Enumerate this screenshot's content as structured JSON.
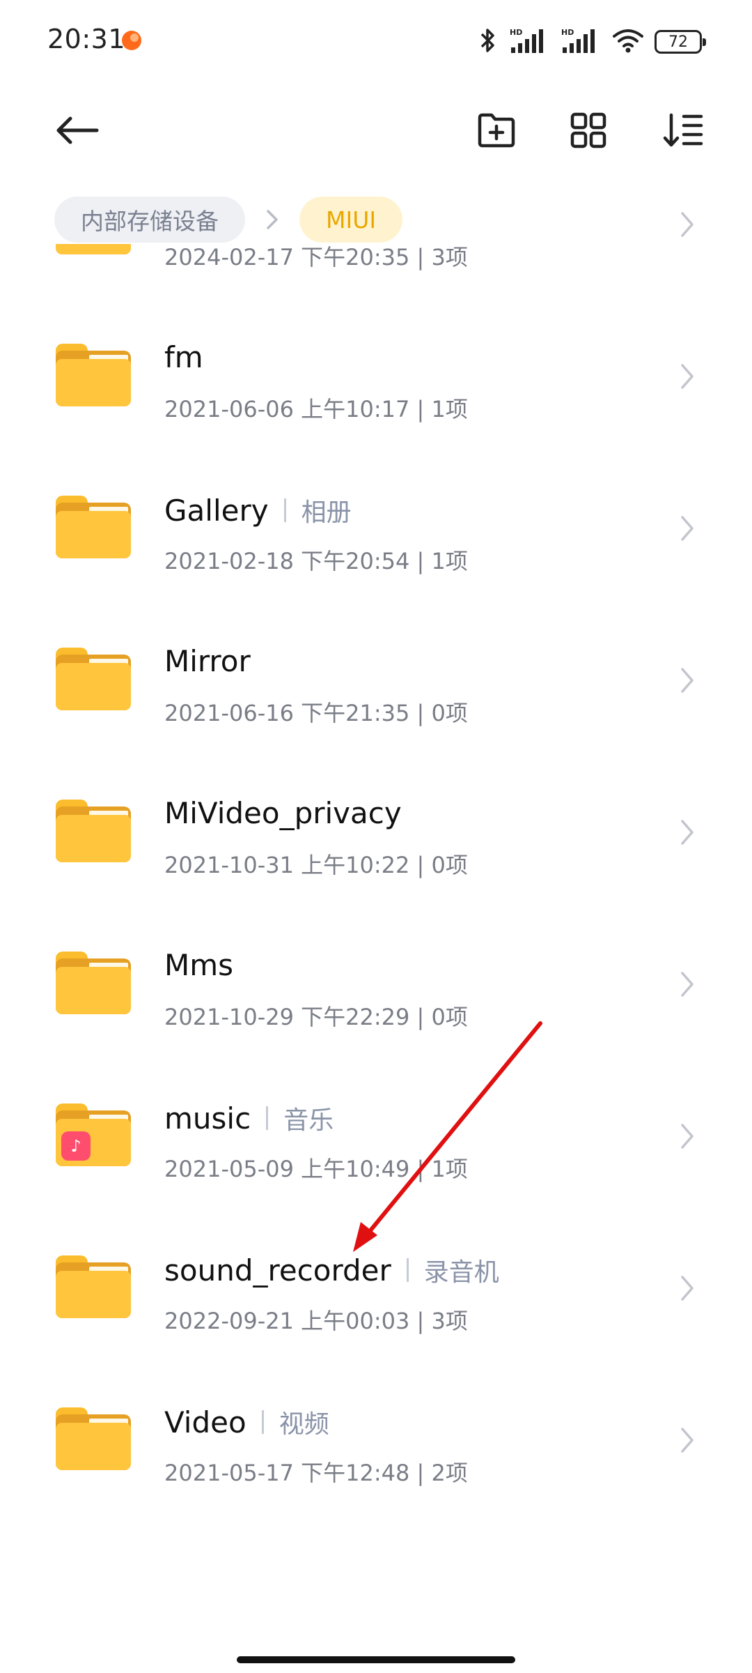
{
  "status_bar": {
    "time": "20:31",
    "battery": "72"
  },
  "breadcrumb": {
    "root": "内部存储设备",
    "current": "MIUI"
  },
  "files": [
    {
      "name": "",
      "alias": "",
      "meta": "2024-02-17 下午20:35  |  3项",
      "special": ""
    },
    {
      "name": "fm",
      "alias": "",
      "meta": "2021-06-06 上午10:17  |  1项",
      "special": ""
    },
    {
      "name": "Gallery",
      "alias": "相册",
      "meta": "2021-02-18 下午20:54  |  1项",
      "special": ""
    },
    {
      "name": "Mirror",
      "alias": "",
      "meta": "2021-06-16 下午21:35  |  0项",
      "special": ""
    },
    {
      "name": "MiVideo_privacy",
      "alias": "",
      "meta": "2021-10-31 上午10:22  |  0项",
      "special": ""
    },
    {
      "name": "Mms",
      "alias": "",
      "meta": "2021-10-29 下午22:29  |  0项",
      "special": ""
    },
    {
      "name": "music",
      "alias": "音乐",
      "meta": "2021-05-09 上午10:49  |  1项",
      "special": "music-badge"
    },
    {
      "name": "sound_recorder",
      "alias": "录音机",
      "meta": "2022-09-21 上午00:03  |  3项",
      "special": ""
    },
    {
      "name": "Video",
      "alias": "视频",
      "meta": "2021-05-17 下午12:48  |  2项",
      "special": ""
    }
  ],
  "colors": {
    "folder": "#ffc53d",
    "accent": "#e9a700",
    "annotation_arrow": "#e01010"
  }
}
